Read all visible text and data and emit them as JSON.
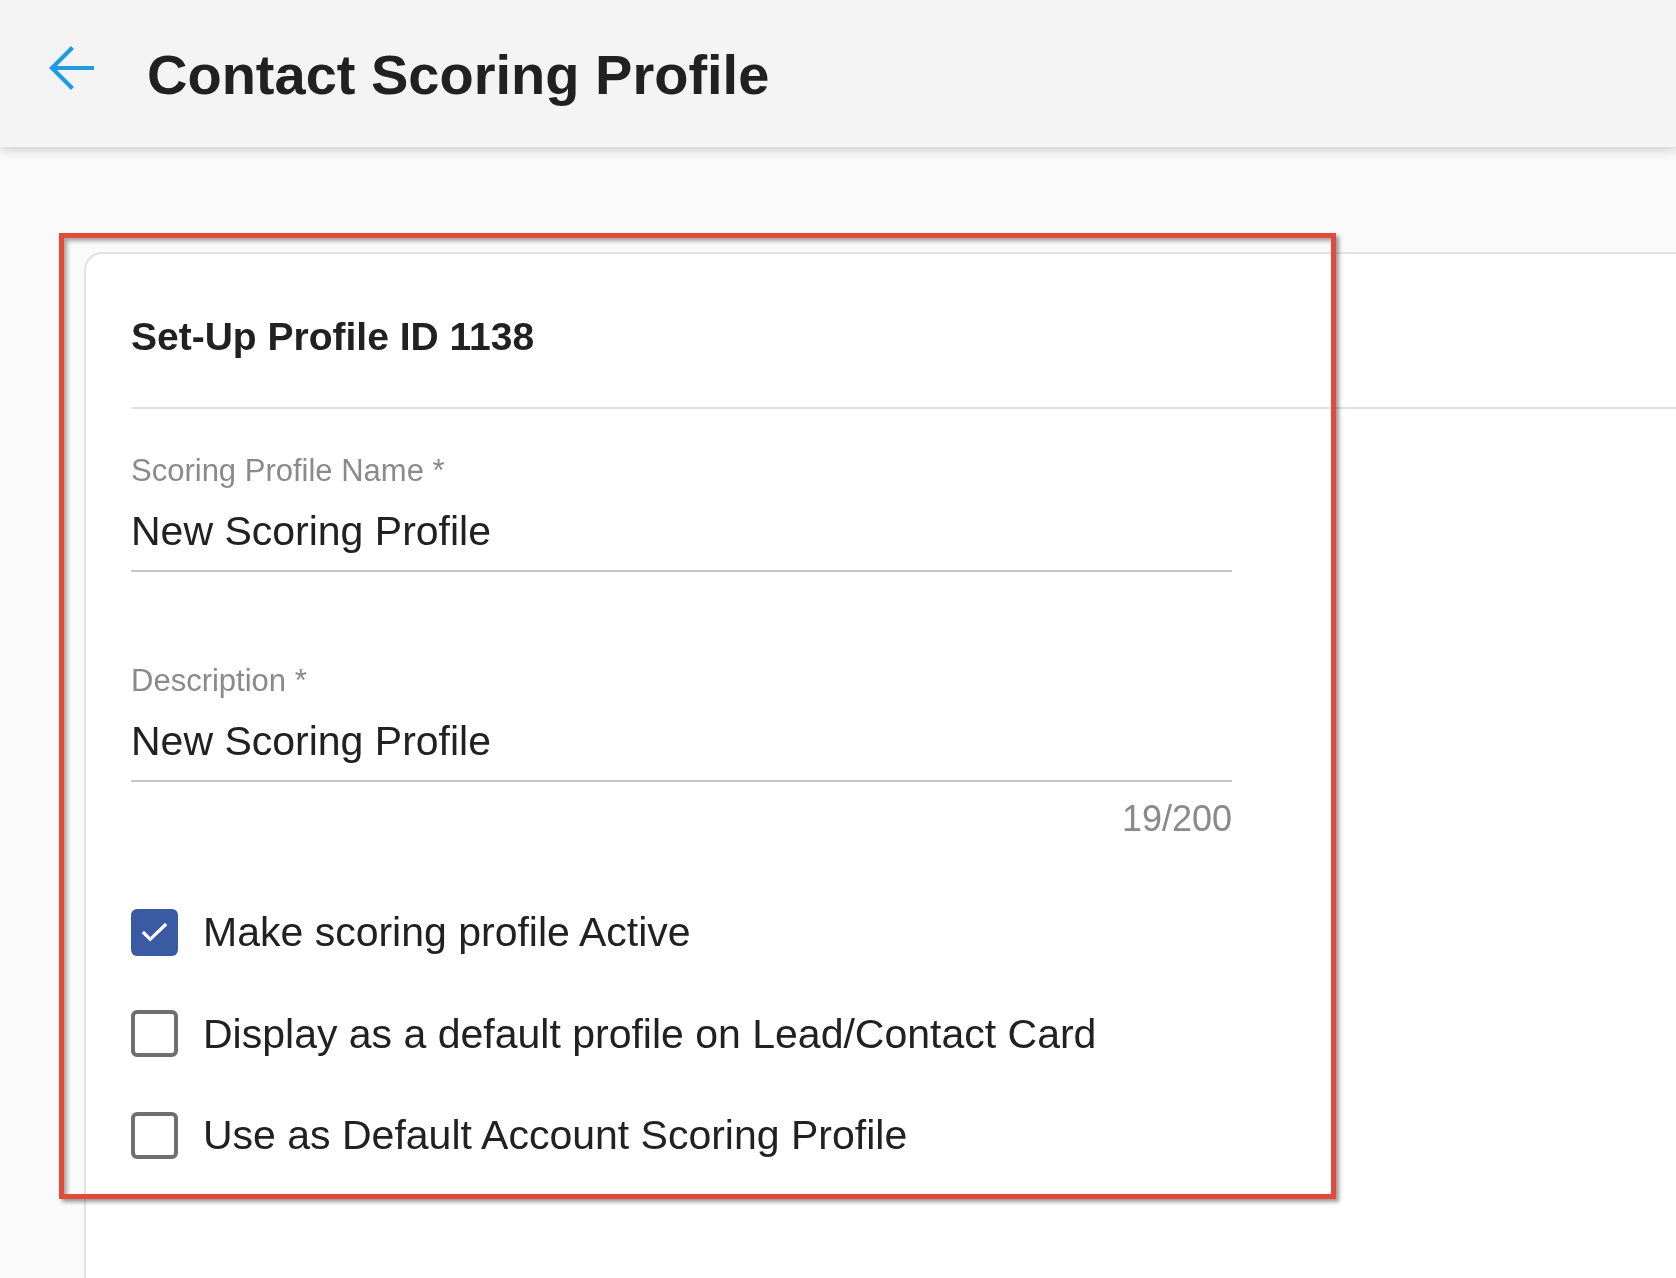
{
  "header": {
    "title": "Contact Scoring Profile"
  },
  "card": {
    "title": "Set-Up Profile ID 1138",
    "fields": [
      {
        "label": "Scoring Profile Name *",
        "value": "New Scoring Profile"
      },
      {
        "label": "Description *",
        "value": "New Scoring Profile",
        "counter": "19/200"
      }
    ],
    "options": [
      {
        "label": "Make scoring profile Active",
        "checked": true
      },
      {
        "label": "Display as a default profile on Lead/Contact Card",
        "checked": false
      },
      {
        "label": "Use as Default Account Scoring Profile",
        "checked": false
      }
    ]
  }
}
